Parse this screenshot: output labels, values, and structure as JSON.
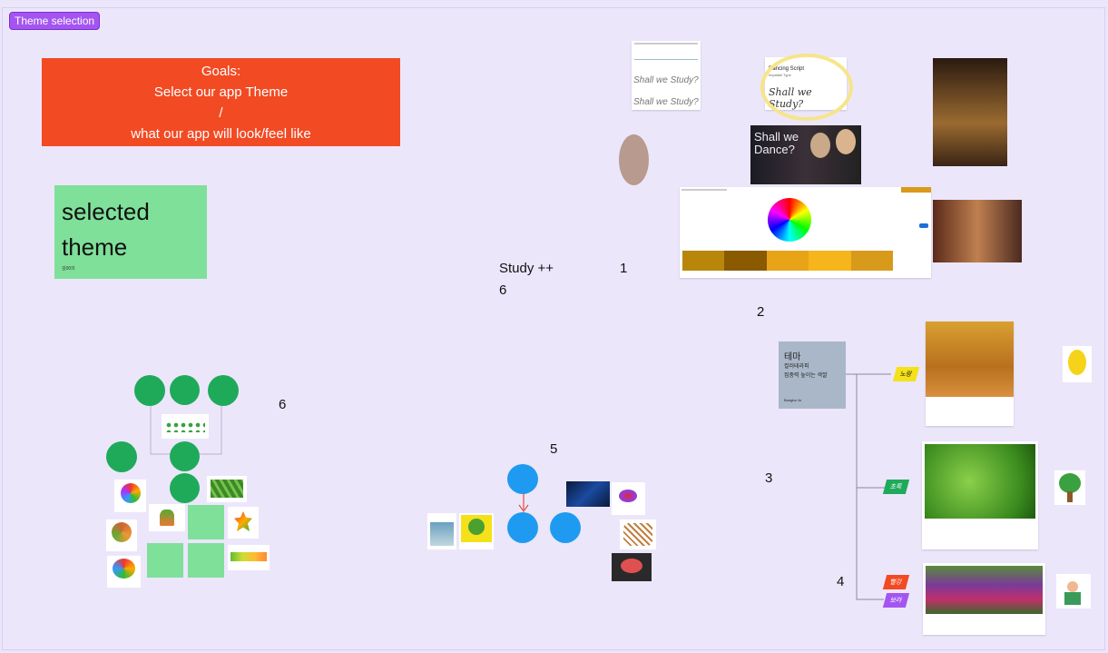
{
  "section_tag": "Theme selection",
  "goals": {
    "line1": "Goals:",
    "line2": "Select our app Theme",
    "line3": "/",
    "line4": "what our app will look/feel like"
  },
  "selected_theme": {
    "line1": "selected",
    "line2": "theme",
    "author": "김00의"
  },
  "study_label": "Study ++",
  "numbers": {
    "n1": "1",
    "n2": "2",
    "n3": "3",
    "n4": "4",
    "n5": "5",
    "n6a": "6",
    "n6b": "6"
  },
  "font_card": {
    "title": "Dancing Script",
    "subtitle": "Impallari Type",
    "sample": "Shall we Study?",
    "sample_small_1": "Shall we Study?",
    "sample_small_2": "Shall we Study?"
  },
  "movie_poster_text": "Shall we Dance?",
  "theme_card": {
    "title": "테마",
    "line1": "컬러테라피",
    "line2": "집중력 높이는 색깔",
    "author": "Bongbo Jo"
  },
  "tags": {
    "yellow": "노랑",
    "green": "초록",
    "red": "빨강",
    "purple": "보라"
  },
  "colors": {
    "background": "#ece6fb",
    "goals": "#f24a23",
    "selected": "#7fe09a",
    "tag": "#a455f0",
    "palette": [
      "#b8860b",
      "#8a5a00",
      "#e8a317",
      "#f5b51b",
      "#d89a1a"
    ]
  }
}
